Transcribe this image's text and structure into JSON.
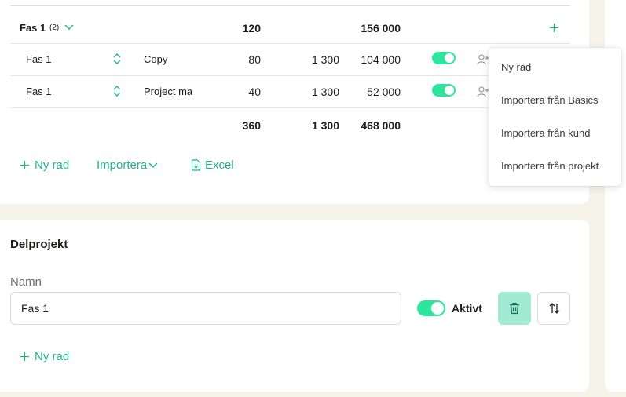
{
  "phase_group": {
    "name": "Fas 1",
    "count": "(2)",
    "qty_total": "120",
    "sum_total": "156 000"
  },
  "rows": [
    {
      "phase": "Fas 1",
      "role": "Copy",
      "qty": "80",
      "price": "1 300",
      "sum": "104 000",
      "active": true
    },
    {
      "phase": "Fas 1",
      "role": "Project ma",
      "qty": "40",
      "price": "1 300",
      "sum": "52 000",
      "active": true
    }
  ],
  "totals": {
    "qty": "360",
    "price": "1 300",
    "sum": "468 000"
  },
  "actions": {
    "new_row": "Ny rad",
    "import": "Importera",
    "excel": "Excel"
  },
  "import_menu": {
    "items": [
      "Ny rad",
      "Importera från Basics",
      "Importera från kund",
      "Importera från projekt"
    ]
  },
  "subproject": {
    "title": "Delprojekt",
    "name_label": "Namn",
    "name_value": "Fas 1",
    "active_label": "Aktivt",
    "active": true,
    "new_row": "Ny rad"
  },
  "colors": {
    "accent": "#1fb58a",
    "toggle": "#2ee59d",
    "delete_button": "#a3ead3",
    "background": "#f6f3e9"
  },
  "icons": [
    "chevron-down-icon",
    "sort-updown-icon",
    "person-add-icon",
    "plus-icon",
    "excel-file-icon",
    "trash-icon",
    "swap-vertical-icon"
  ]
}
